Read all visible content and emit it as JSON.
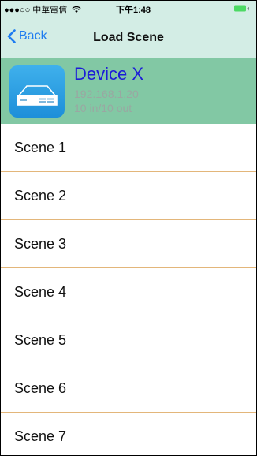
{
  "status_bar": {
    "carrier": "●●●○○ 中華電信",
    "time": "下午1:48"
  },
  "nav": {
    "back_label": "Back",
    "title": "Load Scene"
  },
  "device": {
    "name": "Device X",
    "ip": "192.168.1.20",
    "io": "10 in/10 out",
    "icon": "device-rack-icon"
  },
  "scenes": [
    {
      "label": "Scene 1"
    },
    {
      "label": "Scene 2"
    },
    {
      "label": "Scene 3"
    },
    {
      "label": "Scene 4"
    },
    {
      "label": "Scene 5"
    },
    {
      "label": "Scene 6"
    },
    {
      "label": "Scene 7"
    }
  ],
  "colors": {
    "nav_background": "#d3ede5",
    "device_header_background": "#82c8a4",
    "accent_blue": "#1e7cf0",
    "device_name": "#1c1cd8",
    "separator": "#e3b67a",
    "battery": "#4cd964"
  }
}
